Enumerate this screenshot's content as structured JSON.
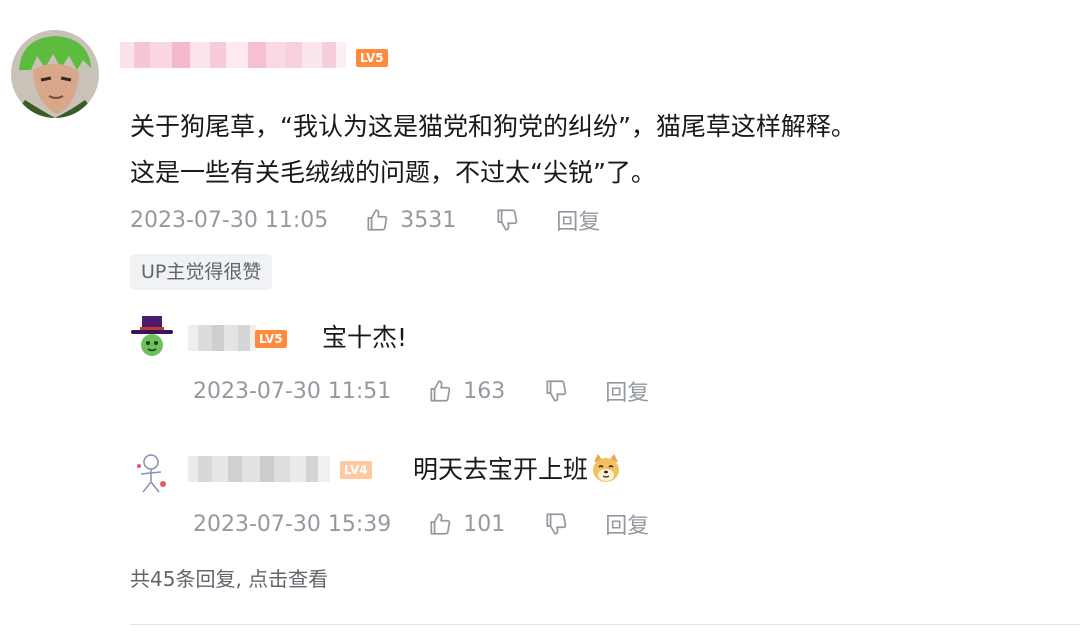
{
  "comment": {
    "level_badge": "LV5",
    "text_lines": [
      "关于狗尾草，“我认为这是猫党和狗党的纠纷”，猫尾草这样解释。",
      "这是一些有关毛绒绒的问题，不过太“尖锐”了。"
    ],
    "time": "2023-07-30 11:05",
    "like_count": "3531",
    "reply_label": "回复",
    "up_liked_tag": "UP主觉得很赞",
    "avatar_icon": "green-hair-anime-avatar"
  },
  "replies": [
    {
      "level_badge": "LV5",
      "text": "宝十杰!",
      "time": "2023-07-30 11:51",
      "like_count": "163",
      "reply_label": "回复",
      "avatar_icon": "top-hat-avatar"
    },
    {
      "level_badge": "LV4",
      "text": "明天去宝开上班",
      "emoji": "doge-emoji",
      "time": "2023-07-30 15:39",
      "like_count": "101",
      "reply_label": "回复",
      "avatar_icon": "sketch-figure-avatar"
    }
  ],
  "view_more": "共45条回复, 点击查看",
  "colors": {
    "text": "#18191c",
    "meta": "#9499a0",
    "badge": "#ff8a3d",
    "tag_bg": "#f1f2f3",
    "username_pink": "#f7c4d4"
  }
}
